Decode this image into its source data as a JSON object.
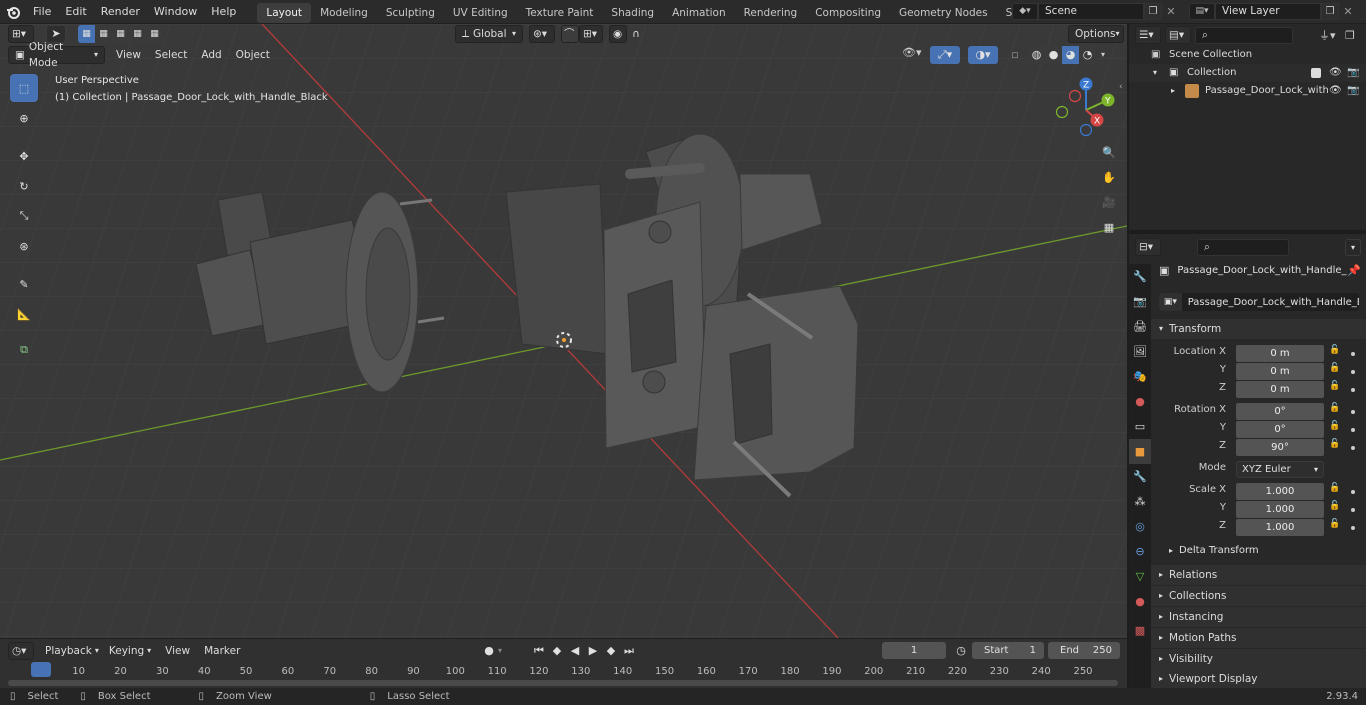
{
  "menu": [
    "File",
    "Edit",
    "Render",
    "Window",
    "Help"
  ],
  "workspaces": [
    "Layout",
    "Modeling",
    "Sculpting",
    "UV Editing",
    "Texture Paint",
    "Shading",
    "Animation",
    "Rendering",
    "Compositing",
    "Geometry Nodes",
    "Scripting"
  ],
  "active_workspace": "Layout",
  "scene": "Scene",
  "view_layer": "View Layer",
  "viewport": {
    "mode": "Object Mode",
    "menus": [
      "View",
      "Select",
      "Add",
      "Object"
    ],
    "transform_orientation": "Global",
    "options": "Options",
    "perspective": "User Perspective",
    "collection_info": "(1) Collection | Passage_Door_Lock_with_Handle_Black",
    "gizmo": {
      "x": "X",
      "y": "Y",
      "z": "Z"
    }
  },
  "outliner": {
    "scene_collection": "Scene Collection",
    "collection": "Collection",
    "object": "Passage_Door_Lock_with"
  },
  "properties": {
    "object_header": "Passage_Door_Lock_with_Handle_Bl...",
    "object_name": "Passage_Door_Lock_with_Handle_Black",
    "transform_title": "Transform",
    "location": {
      "label_x": "Location X",
      "label_y": "Y",
      "label_z": "Z",
      "x": "0 m",
      "y": "0 m",
      "z": "0 m"
    },
    "rotation": {
      "label_x": "Rotation X",
      "label_y": "Y",
      "label_z": "Z",
      "x": "0°",
      "y": "0°",
      "z": "90°"
    },
    "mode_label": "Mode",
    "mode": "XYZ Euler",
    "scale": {
      "label_x": "Scale X",
      "label_y": "Y",
      "label_z": "Z",
      "x": "1.000",
      "y": "1.000",
      "z": "1.000"
    },
    "delta_transform": "Delta Transform",
    "panels": [
      "Relations",
      "Collections",
      "Instancing",
      "Motion Paths",
      "Visibility",
      "Viewport Display"
    ]
  },
  "timeline": {
    "menus": [
      "Playback",
      "Keying",
      "View",
      "Marker"
    ],
    "current_frame": "1",
    "start_label": "Start",
    "start": "1",
    "end_label": "End",
    "end": "250",
    "ticks": [
      "1",
      "10",
      "20",
      "30",
      "40",
      "50",
      "60",
      "70",
      "80",
      "90",
      "100",
      "110",
      "120",
      "130",
      "140",
      "150",
      "160",
      "170",
      "180",
      "190",
      "200",
      "210",
      "220",
      "230",
      "240",
      "250"
    ]
  },
  "statusbar": {
    "select": "Select",
    "box_select": "Box Select",
    "zoom_view": "Zoom View",
    "lasso_select": "Lasso Select",
    "version": "2.93.4"
  }
}
